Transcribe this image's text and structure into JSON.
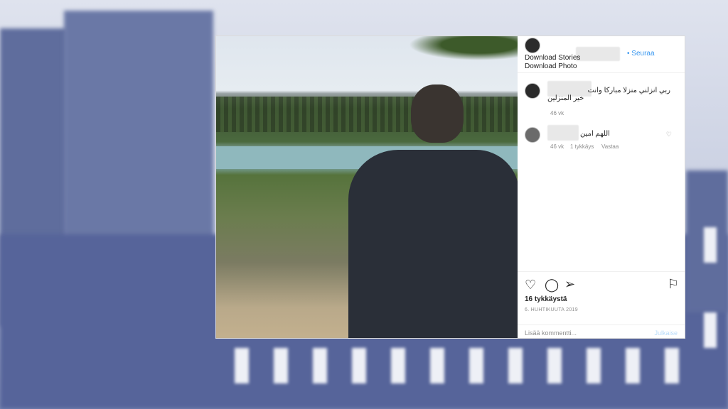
{
  "header": {
    "download_stories": "Download Stories",
    "download_photo": "Download Photo",
    "follow_label": "• Seuraa"
  },
  "comments": [
    {
      "text_line1": "ربي انزلني منزلا مباركا وانت",
      "text_line2": "خير المنزلين",
      "time": "46 vk"
    },
    {
      "text": "اللهم امين",
      "time": "46 vk",
      "likes": "1 tykkäys",
      "reply": "Vastaa"
    }
  ],
  "actions": {
    "likes_count": "16 tykkäystä",
    "date": "6. HUHTIKUUTA 2019"
  },
  "comment_box": {
    "placeholder": "Lisää kommentti...",
    "post_label": "Julkaise"
  },
  "colors": {
    "link_blue": "#3897f0",
    "background_tint": "#5f6d9d"
  }
}
